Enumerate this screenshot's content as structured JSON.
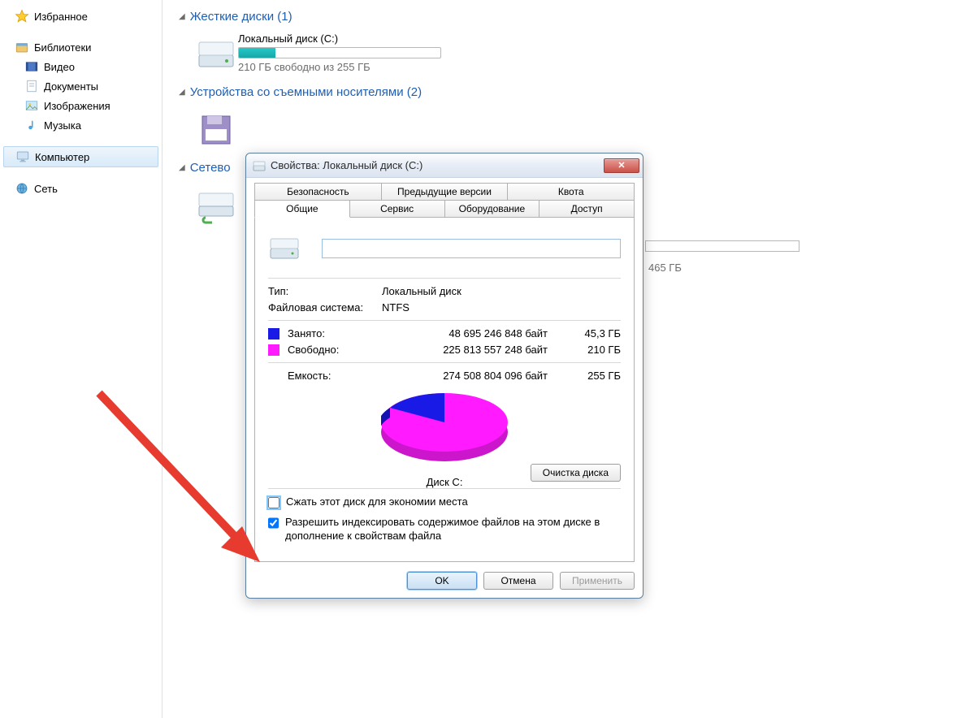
{
  "sidebar": {
    "favorites": "Избранное",
    "libraries": "Библиотеки",
    "video": "Видео",
    "documents": "Документы",
    "images": "Изображения",
    "music": "Музыка",
    "computer": "Компьютер",
    "network": "Сеть"
  },
  "sections": {
    "hdd": "Жесткие диски (1)",
    "removable": "Устройства со съемными носителями (2)",
    "netloc": "Сетево"
  },
  "drive": {
    "name": "Локальный диск (C:)",
    "free_text": "210 ГБ свободно из 255 ГБ",
    "fill_percent": 18
  },
  "net_partial": "465 ГБ",
  "dialog": {
    "title": "Свойства: Локальный диск (C:)",
    "tabs_top": [
      "Безопасность",
      "Предыдущие версии",
      "Квота"
    ],
    "tabs_bot": [
      "Общие",
      "Сервис",
      "Оборудование",
      "Доступ"
    ],
    "name_value": "",
    "type_label": "Тип:",
    "type_value": "Локальный диск",
    "fs_label": "Файловая система:",
    "fs_value": "NTFS",
    "used_label": "Занято:",
    "used_bytes": "48 695 246 848 байт",
    "used_gb": "45,3 ГБ",
    "free_label": "Свободно:",
    "free_bytes": "225 813 557 248 байт",
    "free_gb": "210 ГБ",
    "cap_label": "Емкость:",
    "cap_bytes": "274 508 804 096 байт",
    "cap_gb": "255 ГБ",
    "disk_label": "Диск C:",
    "cleanup": "Очистка диска",
    "compress": "Сжать этот диск для экономии места",
    "index": "Разрешить индексировать содержимое файлов на этом диске в дополнение к свойствам файла",
    "ok": "OK",
    "cancel": "Отмена",
    "apply": "Применить"
  },
  "chart_data": {
    "type": "pie",
    "title": "Диск C:",
    "series": [
      {
        "name": "Занято",
        "value": 48695246848,
        "color": "#1a1ae6"
      },
      {
        "name": "Свободно",
        "value": 225813557248,
        "color": "#ff1aff"
      }
    ]
  }
}
